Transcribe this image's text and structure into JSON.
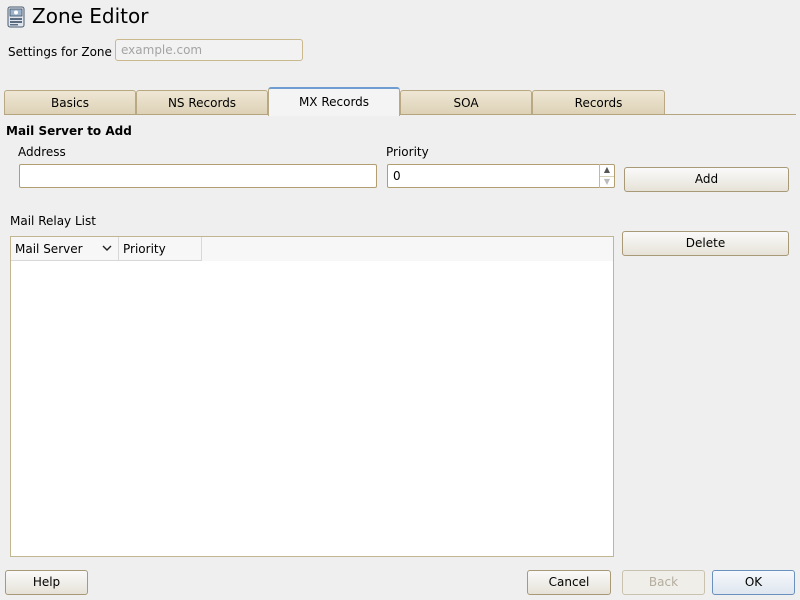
{
  "window": {
    "title": "Zone Editor",
    "icon": "network-card-icon"
  },
  "zone": {
    "label": "Settings for Zone",
    "value": "example.com"
  },
  "tabs": [
    {
      "label": "Basics",
      "active": false
    },
    {
      "label": "NS Records",
      "active": false
    },
    {
      "label": "MX Records",
      "active": true
    },
    {
      "label": "SOA",
      "active": false
    },
    {
      "label": "Records",
      "active": false
    }
  ],
  "mail_server": {
    "section_title": "Mail Server to Add",
    "address_label": "Address",
    "address_value": "",
    "priority_label": "Priority",
    "priority_value": "0",
    "add_label": "Add"
  },
  "relay_list": {
    "title": "Mail Relay List",
    "columns": [
      "Mail Server",
      "Priority"
    ],
    "rows": [],
    "delete_label": "Delete"
  },
  "footer": {
    "help_label": "Help",
    "cancel_label": "Cancel",
    "back_label": "Back",
    "ok_label": "OK"
  },
  "colors": {
    "background": "#efefef",
    "active_tab_accent": "#6e9ed1",
    "border_accent": "#b19f72"
  }
}
